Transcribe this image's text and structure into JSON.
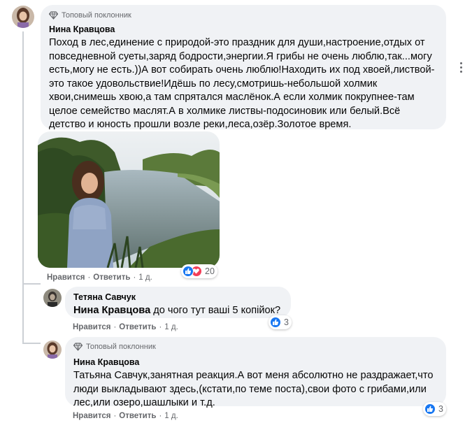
{
  "comments": [
    {
      "badge": "Топовый поклонник",
      "author": "Нина Кравцова",
      "text": "Поход в лес,единение с природой-это праздник для души,настроение,отдых от повседневной суеты,заряд бодрости,энергии.Я грибы не очень люблю,так...могу есть,могу не есть.))А вот собирать очень люблю!Находить их под хвоей,листвой-это такое удовольствие!Идёшь по лесу,смотришь-небольшой холмик хвои,снимешь хвою,а там спрятался маслёнок.А если холмик покрупнее-там целое семейство маслят.А в холмике листвы-подосиновик или белый.Всё детство и юность прошли возле реки,леса,озёр.Золотое время.",
      "lines": [
        "Поход в лес,единение с природой-это праздник для души,настроение,отдых от",
        "повседневной суеты,заряд бодрости,энергии.Я грибы не очень люблю,так...могу",
        "есть,могу не есть.))А вот собирать очень люблю!Находить их под хвоей,листвой-",
        "это такое удовольствие!Идёшь по лесу,смотришь-небольшой холмик",
        "хвои,снимешь хвою,а там спрятался маслёнок.А если холмик покрупнее-там",
        "целое семейство маслят.А в холмике листвы-подосиновик или белый.Всё",
        "детство и юность прошли возле реки,леса,озёр.Золотое время."
      ],
      "like": "Нравится",
      "reply": "Ответить",
      "sep": "·",
      "time": "1 д.",
      "reaction_count": "20"
    },
    {
      "author": "Тетяна Савчук",
      "mention": "Нина Кравцова",
      "text": " до чого тут ваші 5 копійок?",
      "like": "Нравится",
      "reply": "Ответить",
      "sep": "·",
      "time": "1 д.",
      "reaction_count": "3"
    },
    {
      "badge": "Топовый поклонник",
      "author": "Нина Кравцова",
      "lines": [
        "Татьяна Савчук,занятная реакция.А вот меня абсолютно не раздражает,что",
        "люди выкладывают здесь,(кстати,по теме поста),свои фото с грибами,или",
        "лес,или озеро,шашлыки и т.д."
      ],
      "like": "Нравится",
      "reply": "Ответить",
      "sep": "·",
      "time": "1 д.",
      "reaction_count": "3"
    }
  ],
  "colors": {
    "bubble": "#f0f2f5",
    "secondary_text": "#65676b",
    "like_blue": "#1877f2",
    "love_red": "#f33e58"
  },
  "icons": [
    "gem-badge-icon",
    "like-reaction-icon",
    "love-reaction-icon",
    "more-options-icon"
  ]
}
